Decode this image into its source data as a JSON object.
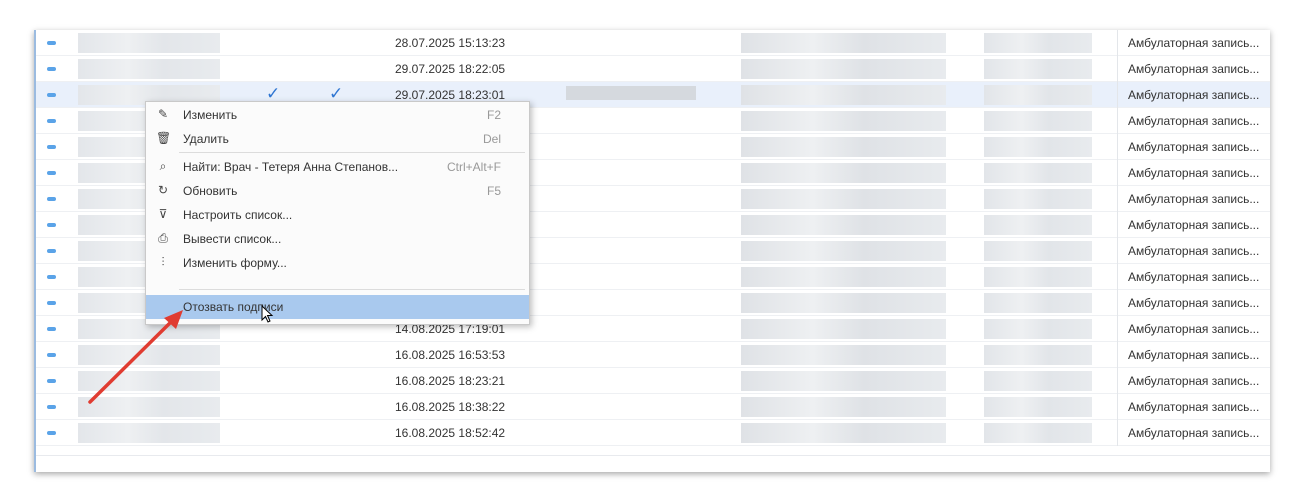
{
  "colors": {
    "accent": "#2f76d2",
    "highlight": "#a9c9ee",
    "arrow": "#e03c31"
  },
  "rows": [
    {
      "date": "28.07.2025 15:13:23",
      "type": "Амбулаторная запись...",
      "checks": false
    },
    {
      "date": "29.07.2025 18:22:05",
      "type": "Амбулаторная запись...",
      "checks": false
    },
    {
      "date": "29.07.2025 18:23:01",
      "type": "Амбулаторная запись...",
      "checks": true
    },
    {
      "date": "",
      "type": "Амбулаторная запись...",
      "checks": false
    },
    {
      "date": "",
      "type": "Амбулаторная запись...",
      "checks": false
    },
    {
      "date": "",
      "type": "Амбулаторная запись...",
      "checks": false
    },
    {
      "date": "",
      "type": "Амбулаторная запись...",
      "checks": false
    },
    {
      "date": "",
      "type": "Амбулаторная запись...",
      "checks": false
    },
    {
      "date": "",
      "type": "Амбулаторная запись...",
      "checks": false
    },
    {
      "date": "",
      "type": "Амбулаторная запись...",
      "checks": false
    },
    {
      "date": "",
      "type": "Амбулаторная запись...",
      "checks": false
    },
    {
      "date": "14.08.2025 17:19:01",
      "type": "Амбулаторная запись...",
      "checks": false
    },
    {
      "date": "16.08.2025 16:53:53",
      "type": "Амбулаторная запись...",
      "checks": false
    },
    {
      "date": "16.08.2025 18:23:21",
      "type": "Амбулаторная запись...",
      "checks": false
    },
    {
      "date": "16.08.2025 18:38:22",
      "type": "Амбулаторная запись...",
      "checks": false
    },
    {
      "date": "16.08.2025 18:52:42",
      "type": "Амбулаторная запись...",
      "checks": false
    }
  ],
  "context_menu": {
    "items": [
      {
        "icon": "pencil-icon",
        "glyph": "✎",
        "label": "Изменить",
        "shortcut": "F2"
      },
      {
        "icon": "trash-icon",
        "glyph": "🗑",
        "label": "Удалить",
        "shortcut": "Del"
      },
      {
        "icon": "search-doc-icon",
        "glyph": "⌕",
        "label": "Найти: Врач - Тетеря Анна Степанов...",
        "shortcut": "Ctrl+Alt+F"
      },
      {
        "icon": "refresh-icon",
        "glyph": "↻",
        "label": "Обновить",
        "shortcut": "F5"
      },
      {
        "icon": "filter-icon",
        "glyph": "⊽",
        "label": "Настроить список...",
        "shortcut": ""
      },
      {
        "icon": "print-icon",
        "glyph": "⎙",
        "label": "Вывести список...",
        "shortcut": ""
      },
      {
        "icon": "form-settings-icon",
        "glyph": "⫶",
        "label": "Изменить форму...",
        "shortcut": ""
      },
      {
        "icon": "",
        "glyph": "",
        "label": "Отозвать подписи",
        "shortcut": ""
      }
    ]
  }
}
